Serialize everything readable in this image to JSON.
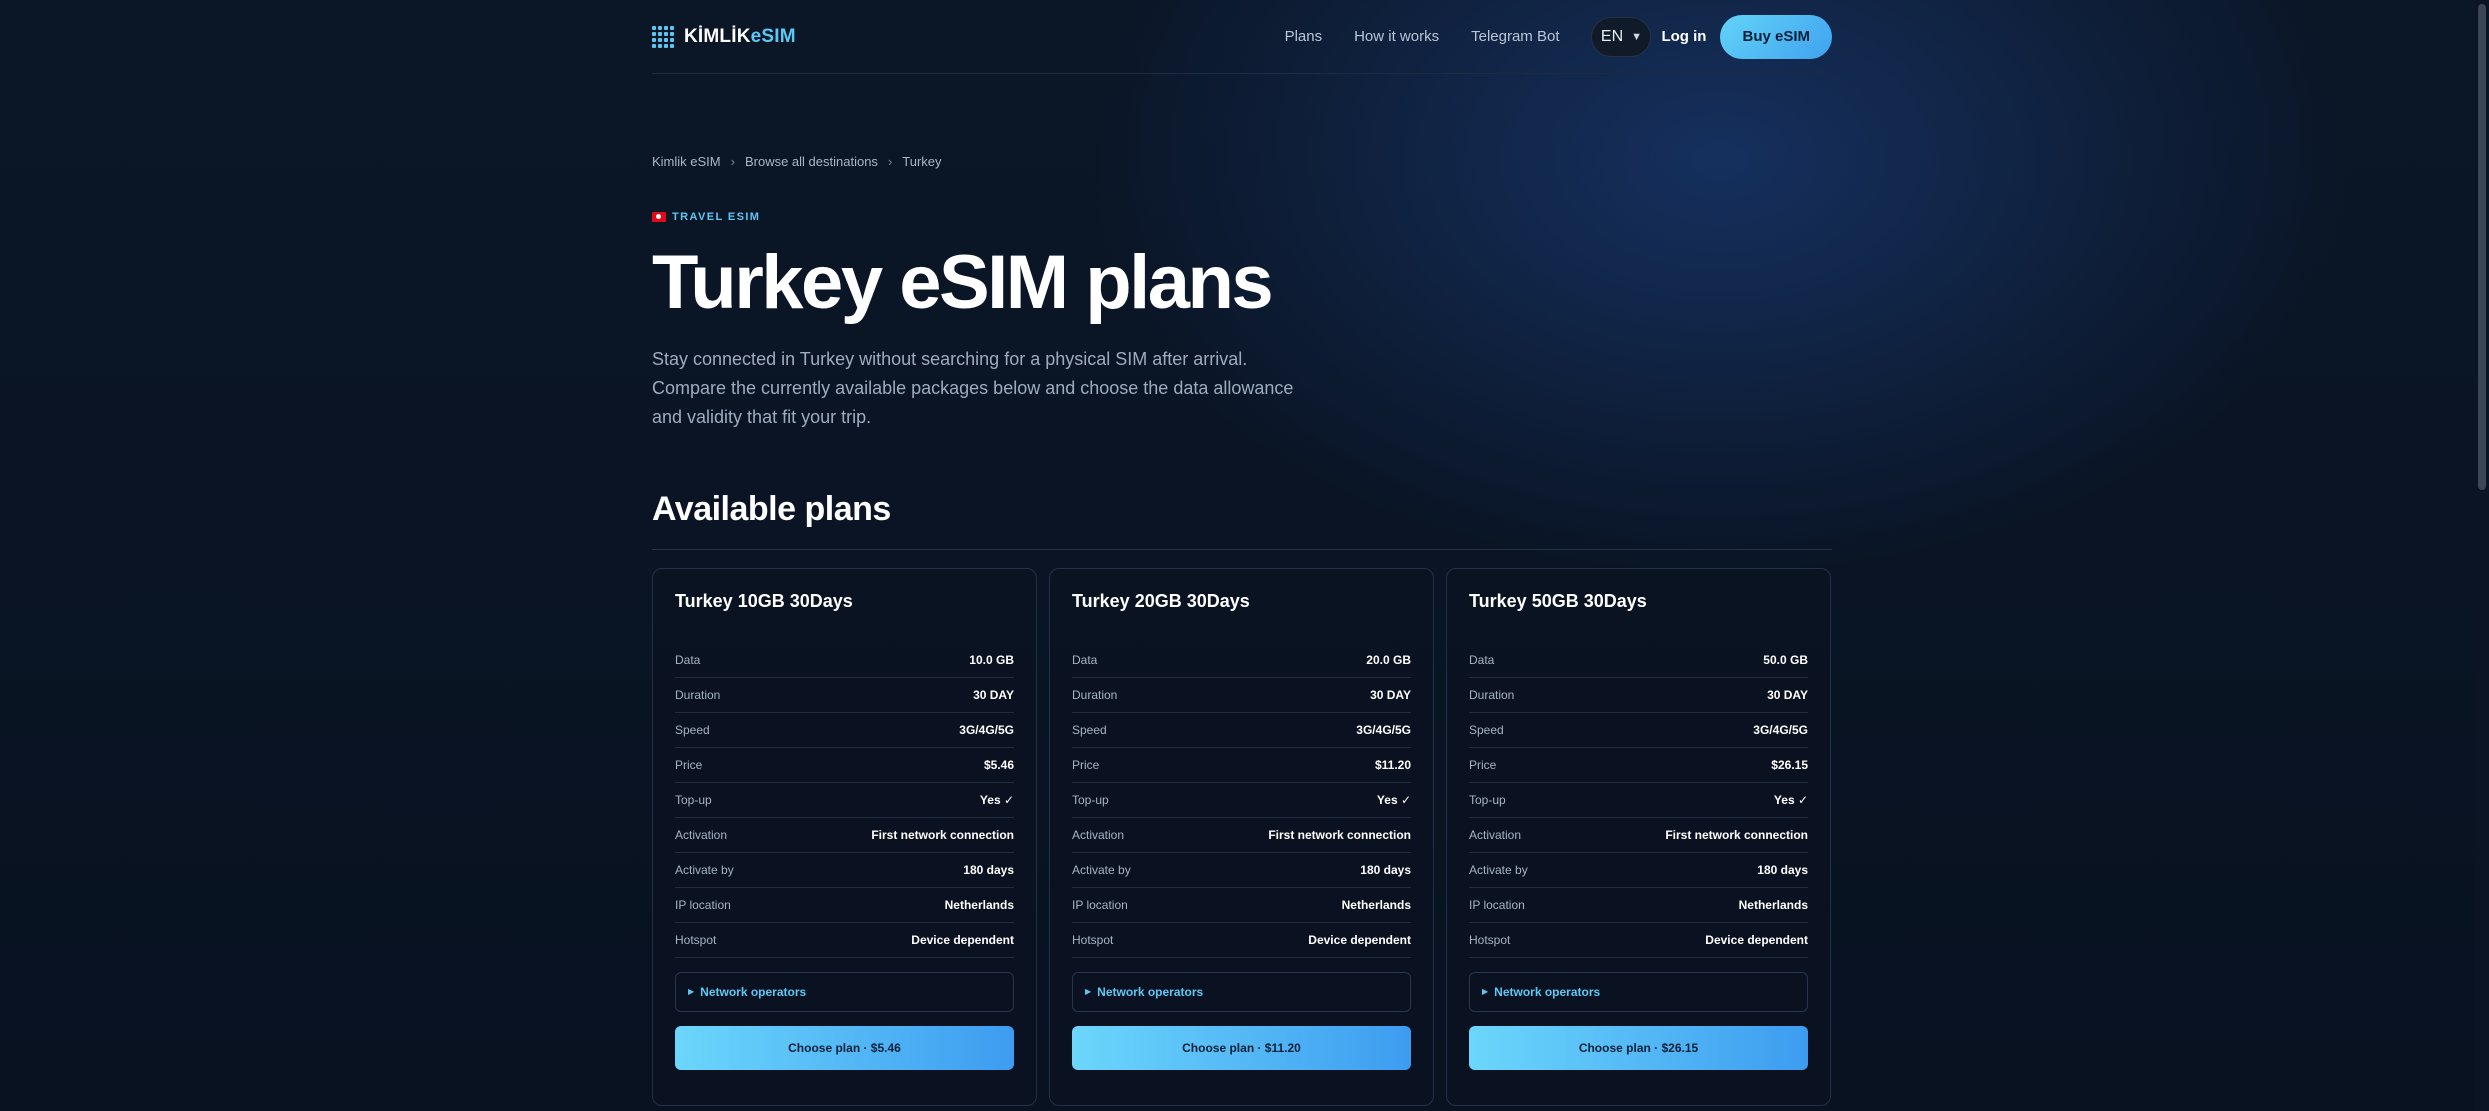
{
  "brand": {
    "name_part1": "KİMLİK",
    "name_part2": "eSIM"
  },
  "nav": {
    "plans": "Plans",
    "how": "How it works",
    "telegram": "Telegram Bot",
    "lang": "EN",
    "login": "Log in",
    "buy": "Buy eSIM"
  },
  "breadcrumb": {
    "home": "Kimlik eSIM",
    "all": "Browse all destinations",
    "current": "Turkey",
    "sep": "›"
  },
  "hero": {
    "eyebrow": "TRAVEL ESIM",
    "title": "Turkey eSIM plans",
    "lead": "Stay connected in Turkey without searching for a physical SIM after arrival. Compare the currently available packages below and choose the data allowance and validity that fit your trip."
  },
  "section": {
    "title": "Available plans"
  },
  "labels": {
    "data": "Data",
    "duration": "Duration",
    "speed": "Speed",
    "price": "Price",
    "topup": "Top-up",
    "activation": "Activation",
    "activate_by": "Activate by",
    "ip": "IP location",
    "hotspot": "Hotspot",
    "operators": "Network operators"
  },
  "plans": [
    {
      "title": "Turkey 10GB 30Days",
      "data": "10.0 GB",
      "duration": "30 DAY",
      "speed": "3G/4G/5G",
      "price": "$5.46",
      "topup": "Yes ✓",
      "activation": "First network connection",
      "activate_by": "180 days",
      "ip": "Netherlands",
      "hotspot": "Device dependent",
      "cta": "Choose plan · $5.46"
    },
    {
      "title": "Turkey 20GB 30Days",
      "data": "20.0 GB",
      "duration": "30 DAY",
      "speed": "3G/4G/5G",
      "price": "$11.20",
      "topup": "Yes ✓",
      "activation": "First network connection",
      "activate_by": "180 days",
      "ip": "Netherlands",
      "hotspot": "Device dependent",
      "cta": "Choose plan · $11.20"
    },
    {
      "title": "Turkey 50GB 30Days",
      "data": "50.0 GB",
      "duration": "30 DAY",
      "speed": "3G/4G/5G",
      "price": "$26.15",
      "topup": "Yes ✓",
      "activation": "First network connection",
      "activate_by": "180 days",
      "ip": "Netherlands",
      "hotspot": "Device dependent",
      "cta": "Choose plan · $26.15"
    }
  ]
}
